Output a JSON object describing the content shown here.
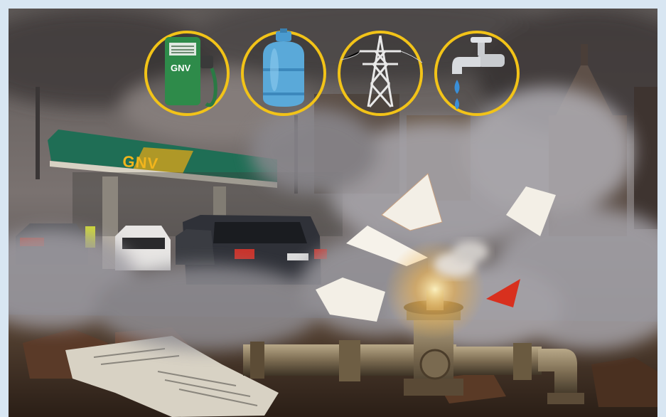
{
  "illustration": {
    "station_sign_label": "GNV",
    "pump_icon_label": "GNV",
    "icons": [
      {
        "name": "gas-pump-icon",
        "color": "#2e8b4a"
      },
      {
        "name": "gas-cylinder-icon",
        "color": "#5aa9d9"
      },
      {
        "name": "power-pylon-icon",
        "color": "#e8e8e8"
      },
      {
        "name": "water-tap-icon",
        "color": "#c9ccd0"
      }
    ],
    "colors": {
      "circle_ring": "#f2c318",
      "sign_band": "#1f6e55",
      "sign_accent": "#c9a020",
      "smoke": "#9c9aa0",
      "pipe": "#8a7a5a"
    }
  }
}
